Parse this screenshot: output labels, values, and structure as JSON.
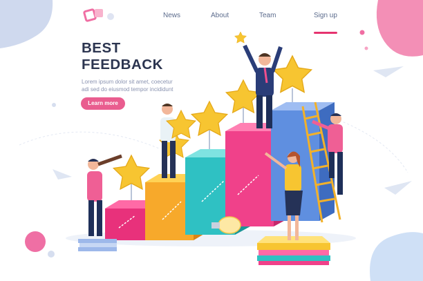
{
  "nav": {
    "items": [
      {
        "label": "News"
      },
      {
        "label": "About"
      },
      {
        "label": "Team"
      },
      {
        "label": "Sign up"
      }
    ]
  },
  "hero": {
    "title_line1": "BEST",
    "title_line2": "FEEDBACK",
    "subtitle_line1": "Lorem ipsum dolor sit amet, coecetur",
    "subtitle_line2": "adi sed do eiusmod tempor incididunt",
    "cta_label": "Learn more"
  },
  "colors": {
    "accent": "#e95d8f",
    "nav_text": "#5b6b8c",
    "headline": "#2c3550",
    "star": "#f7c531"
  },
  "icons": [
    "logo-icon",
    "star-icon",
    "ladder-icon",
    "lightbulb-icon",
    "paper-plane-icon",
    "telescope-icon"
  ]
}
